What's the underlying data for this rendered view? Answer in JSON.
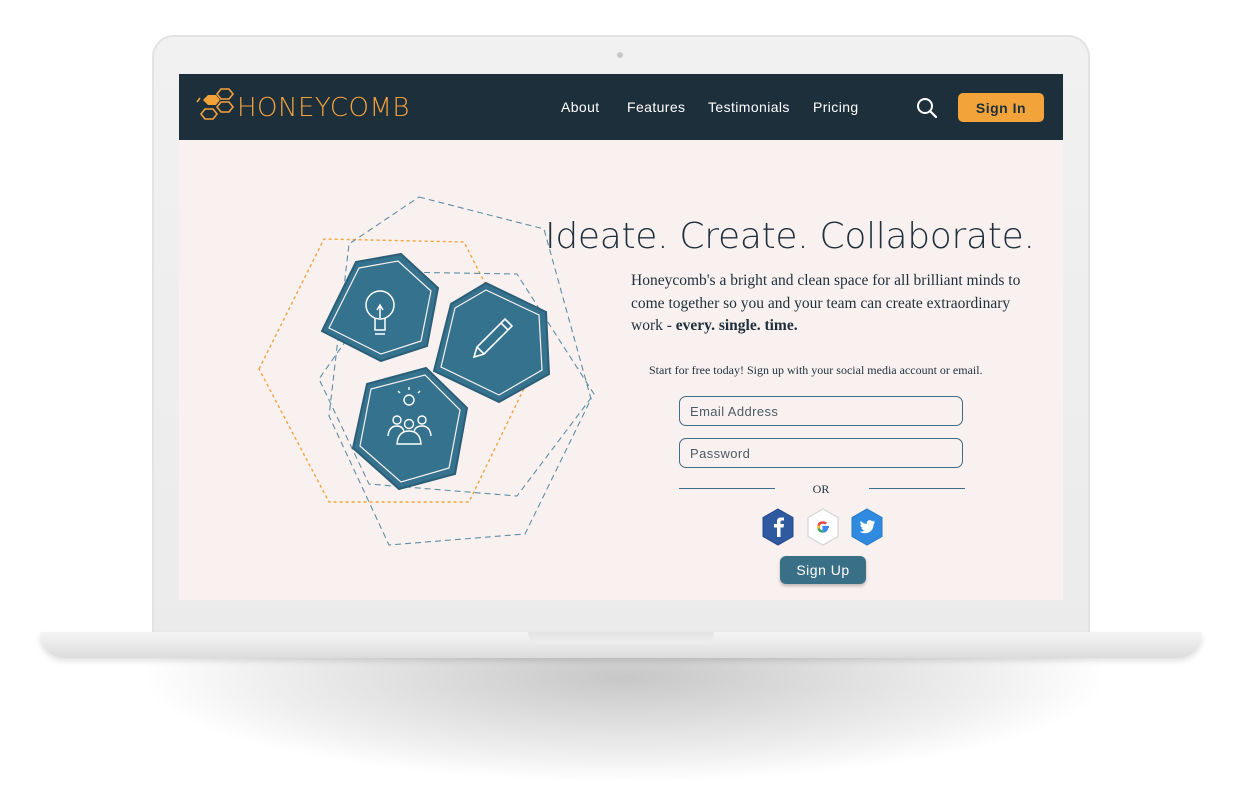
{
  "brand": {
    "name": "HONEYCOMB"
  },
  "nav": {
    "links": [
      "About",
      "Features",
      "Testimonials",
      "Pricing"
    ],
    "search_icon": "search-icon",
    "signin_label": "Sign In"
  },
  "hero": {
    "headline": "Ideate. Create. Collaborate.",
    "tagline": "Honeycomb's a bright and clean space for all brilliant minds to come together so you and your team can create extraordinary work - ",
    "tagline_emphasis": "every. single. time.",
    "icons": [
      "lightbulb-icon",
      "pencil-icon",
      "team-idea-icon"
    ]
  },
  "signup": {
    "cta": "Start for free today! Sign up with your social media account or email.",
    "email_placeholder": "Email Address",
    "password_placeholder": "Password",
    "or_text": "OR",
    "social": [
      "facebook-icon",
      "google-icon",
      "twitter-icon"
    ],
    "submit_label": "Sign Up"
  },
  "colors": {
    "navbar": "#1e2f3c",
    "accent": "#f2a33a",
    "hexagon": "#35728e",
    "background": "#f9f1ef"
  }
}
